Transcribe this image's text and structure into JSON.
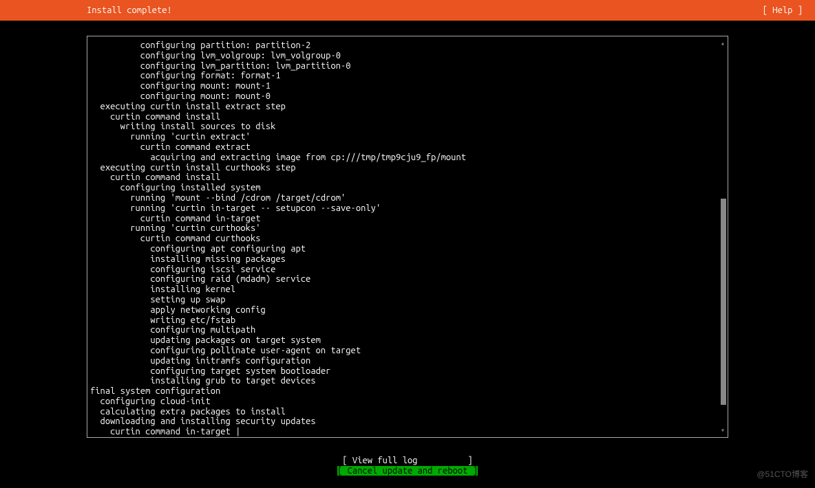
{
  "header": {
    "title": "Install complete!",
    "help": "[ Help ]"
  },
  "log": {
    "lines": [
      "          configuring partition: partition-2",
      "          configuring lvm_volgroup: lvm_volgroup-0",
      "          configuring lvm_partition: lvm_partition-0",
      "          configuring format: format-1",
      "          configuring mount: mount-1",
      "          configuring mount: mount-0",
      "  executing curtin install extract step",
      "    curtin command install",
      "      writing install sources to disk",
      "        running 'curtin extract'",
      "          curtin command extract",
      "            acquiring and extracting image from cp:///tmp/tmp9cju9_fp/mount",
      "  executing curtin install curthooks step",
      "    curtin command install",
      "      configuring installed system",
      "        running 'mount --bind /cdrom /target/cdrom'",
      "        running 'curtin in-target -- setupcon --save-only'",
      "          curtin command in-target",
      "        running 'curtin curthooks'",
      "          curtin command curthooks",
      "            configuring apt configuring apt",
      "            installing missing packages",
      "            configuring iscsi service",
      "            configuring raid (mdadm) service",
      "            installing kernel",
      "            setting up swap",
      "            apply networking config",
      "            writing etc/fstab",
      "            configuring multipath",
      "            updating packages on target system",
      "            configuring pollinate user-agent on target",
      "            updating initramfs configuration",
      "            configuring target system bootloader",
      "            installing grub to target devices",
      "final system configuration",
      "  configuring cloud-init",
      "  calculating extra packages to install",
      "  downloading and installing security updates",
      "    curtin command in-target |"
    ]
  },
  "buttons": {
    "view_log": "[ View full log          ]",
    "cancel_reboot": "[ Cancel update and reboot ]"
  },
  "watermark": "@51CTO博客"
}
